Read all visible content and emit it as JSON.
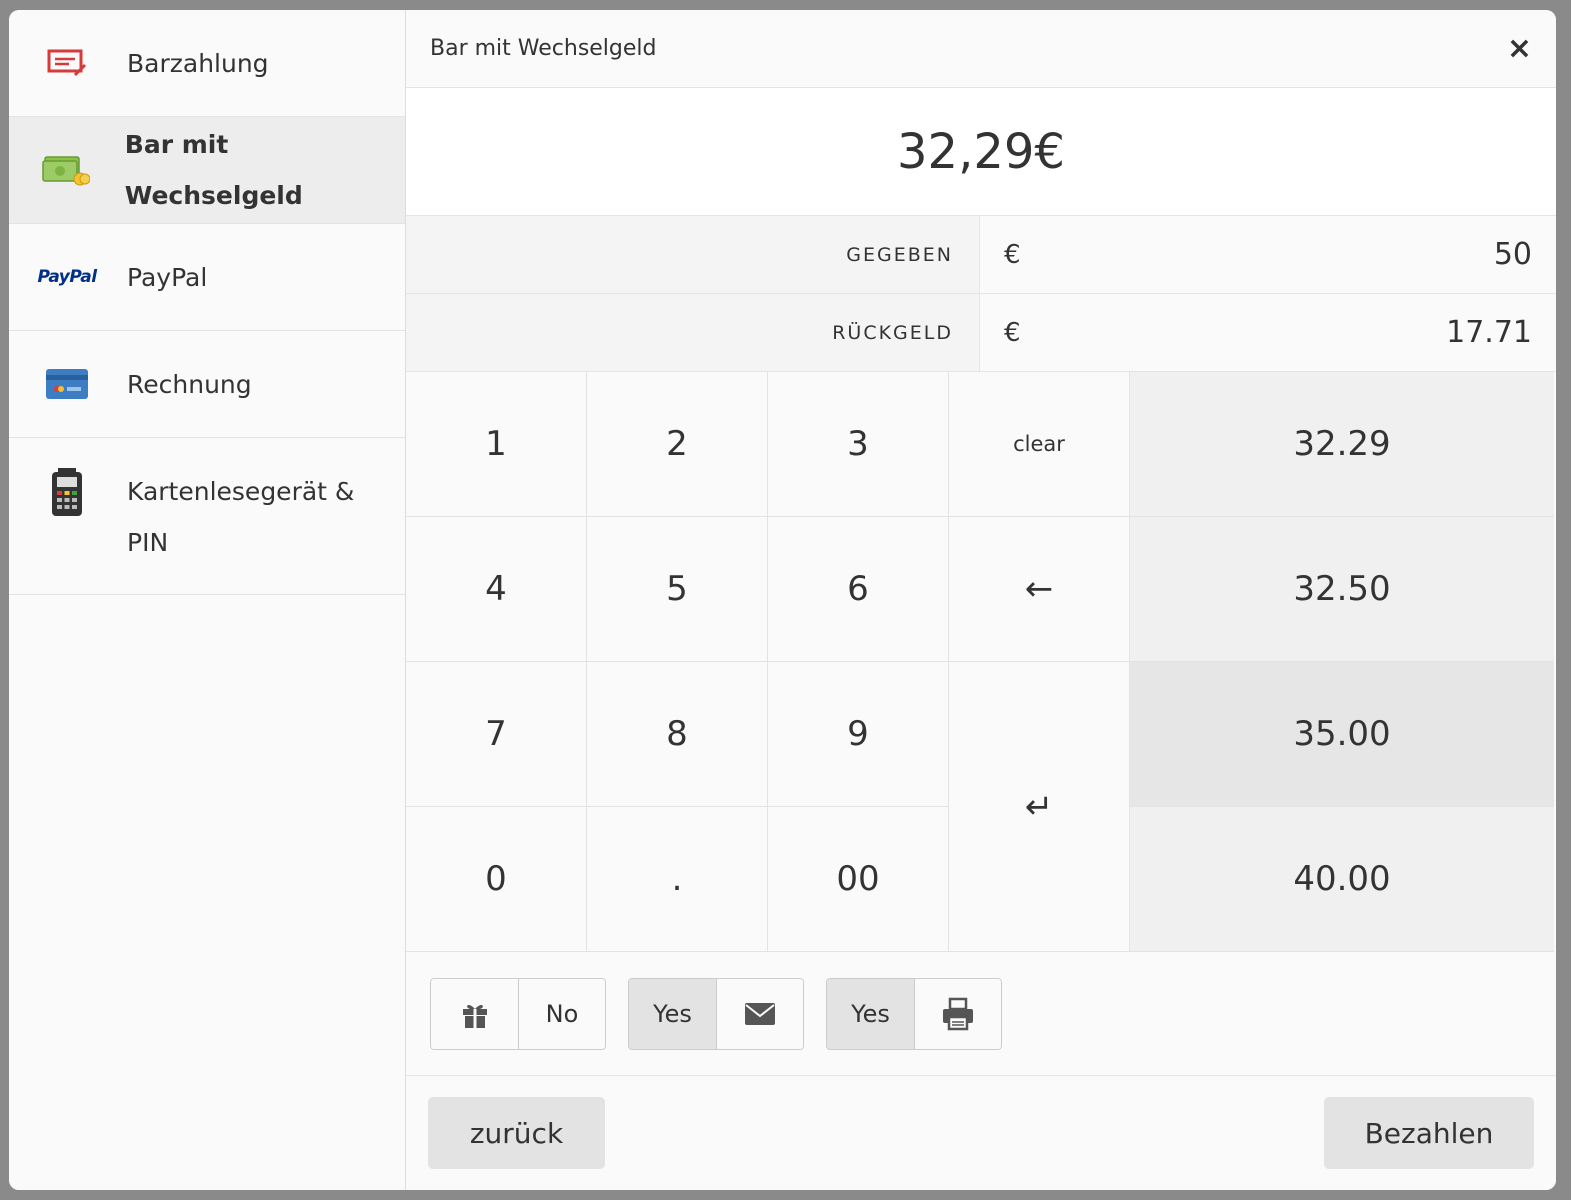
{
  "sidebar": {
    "items": [
      {
        "label": "Barzahlung",
        "icon": "cash-receipt-icon"
      },
      {
        "label": "Bar mit Wechselgeld",
        "icon": "money-coins-icon",
        "active": true
      },
      {
        "label": "PayPal",
        "icon": "paypal-logo-icon",
        "logo_text": "PayPal"
      },
      {
        "label": "Rechnung",
        "icon": "credit-card-icon"
      },
      {
        "label": "Kartenlesegerät &",
        "label2": "PIN",
        "icon": "card-terminal-icon"
      }
    ]
  },
  "header": {
    "title": "Bar mit Wechselgeld",
    "close": "×"
  },
  "total": "32,29€",
  "fields": {
    "given": {
      "label": "GEGEBEN",
      "currency": "€",
      "value": "50"
    },
    "change": {
      "label": "RÜCKGELD",
      "currency": "€",
      "value": "17.71"
    }
  },
  "keypad": {
    "k1": "1",
    "k2": "2",
    "k3": "3",
    "clear": "clear",
    "k4": "4",
    "k5": "5",
    "k6": "6",
    "backspace": "←",
    "k7": "7",
    "k8": "8",
    "k9": "9",
    "enter": "↵",
    "k0": "0",
    "dot": ".",
    "k00": "00"
  },
  "quick_amounts": [
    "32.29",
    "32.50",
    "35.00",
    "40.00"
  ],
  "toggles": {
    "gift": {
      "value": "No",
      "icon": "gift-icon"
    },
    "email": {
      "value": "Yes",
      "icon": "envelope-icon"
    },
    "print": {
      "value": "Yes",
      "icon": "printer-icon"
    }
  },
  "footer": {
    "back": "zurück",
    "pay": "Bezahlen"
  },
  "colors": {
    "accent_red": "#d63b3b",
    "money_green": "#8bc34a",
    "paypal_blue": "#003087",
    "paypal_light": "#009cde",
    "card_blue": "#3d7dc4"
  }
}
